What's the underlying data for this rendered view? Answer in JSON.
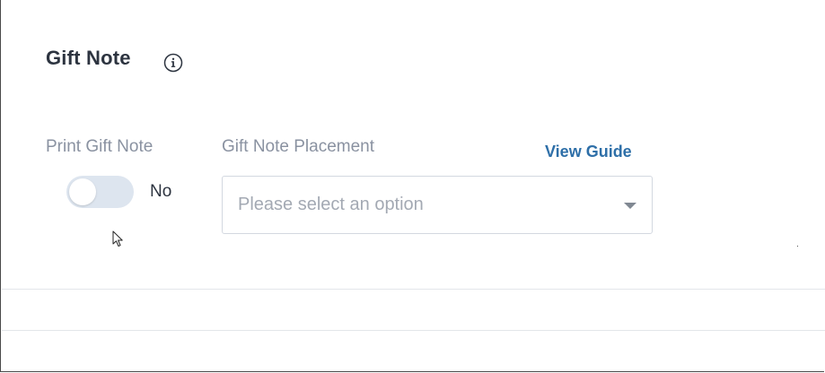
{
  "section": {
    "title": "Gift Note",
    "info_icon": "info-circle-icon"
  },
  "print_gift_note": {
    "label": "Print Gift Note",
    "toggle_on": false,
    "state_text": "No"
  },
  "placement": {
    "label": "Gift Note Placement",
    "guide_link": "View Guide",
    "placeholder": "Please select an option",
    "caret_icon": "caret-down-icon"
  },
  "colors": {
    "title": "#2d3440",
    "label": "#8a92a1",
    "link": "#2e6fa8",
    "toggle_track": "#dde5ef"
  }
}
